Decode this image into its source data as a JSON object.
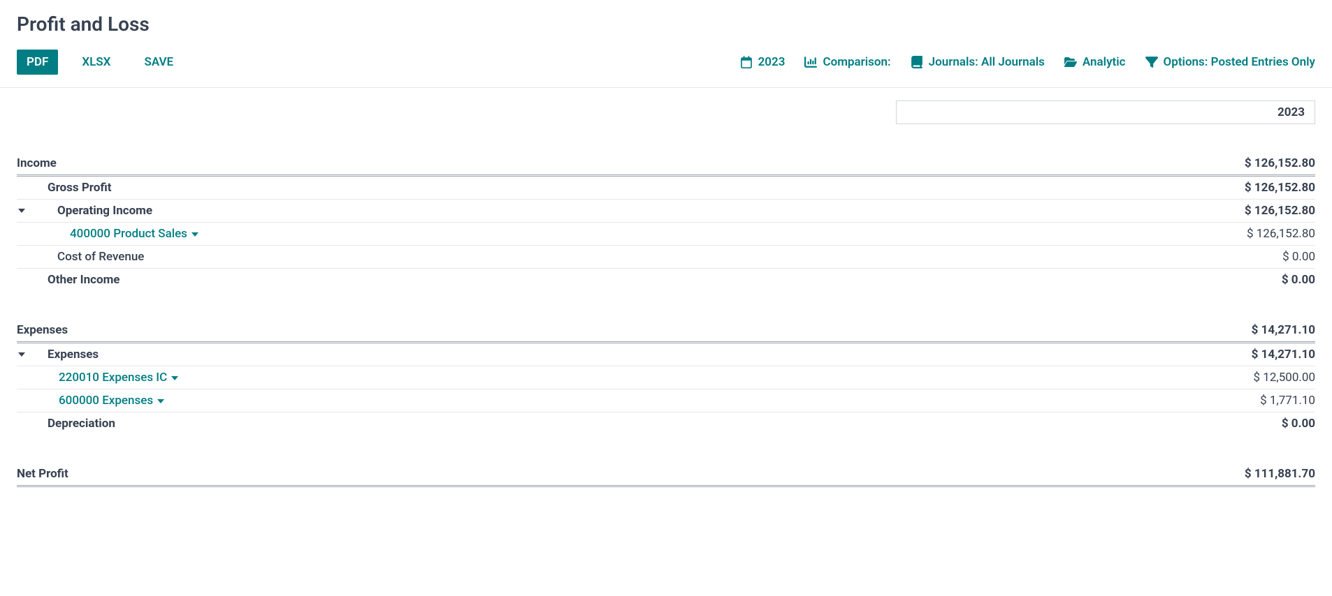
{
  "title": "Profit and Loss",
  "toolbar": {
    "pdf": "PDF",
    "xlsx": "XLSX",
    "save": "SAVE"
  },
  "filters": {
    "period": "2023",
    "comparison": "Comparison:",
    "journals": "Journals: All Journals",
    "analytic": "Analytic",
    "options": "Options: Posted Entries Only"
  },
  "column_header": "2023",
  "income": {
    "label": "Income",
    "value": "$ 126,152.80",
    "gross_profit": {
      "label": "Gross Profit",
      "value": "$ 126,152.80"
    },
    "operating_income": {
      "label": "Operating Income",
      "value": "$ 126,152.80"
    },
    "product_sales": {
      "label": "400000 Product Sales",
      "value": "$ 126,152.80"
    },
    "cost_of_revenue": {
      "label": "Cost of Revenue",
      "value": "$ 0.00"
    },
    "other_income": {
      "label": "Other Income",
      "value": "$ 0.00"
    }
  },
  "expenses": {
    "label": "Expenses",
    "value": "$ 14,271.10",
    "expenses_sub": {
      "label": "Expenses",
      "value": "$ 14,271.10"
    },
    "expenses_ic": {
      "label": "220010 Expenses IC",
      "value": "$ 12,500.00"
    },
    "expenses_600000": {
      "label": "600000 Expenses",
      "value": "$ 1,771.10"
    },
    "depreciation": {
      "label": "Depreciation",
      "value": "$ 0.00"
    }
  },
  "net_profit": {
    "label": "Net Profit",
    "value": "$ 111,881.70"
  }
}
